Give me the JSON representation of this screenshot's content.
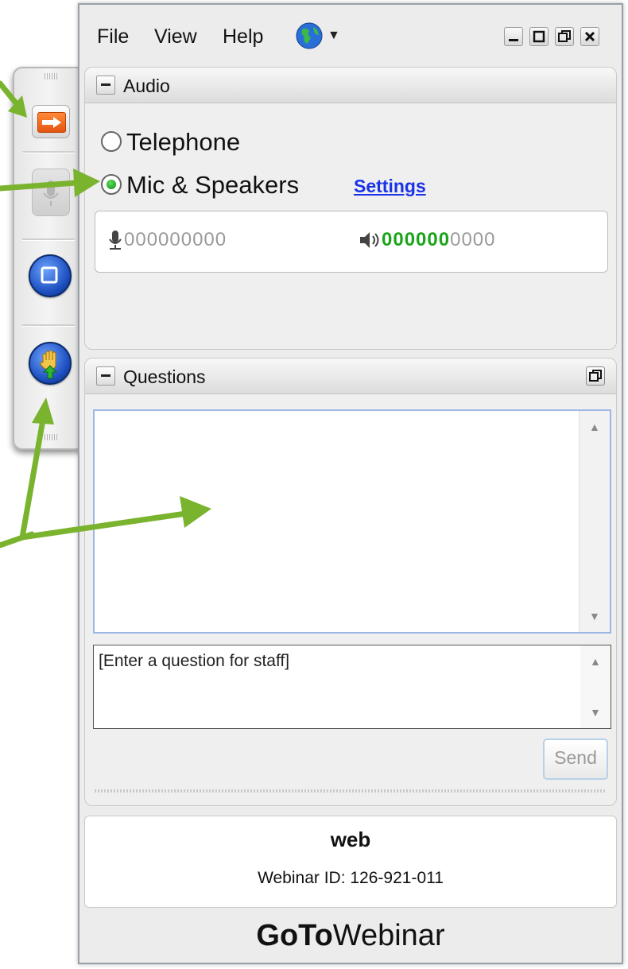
{
  "menu": {
    "file": "File",
    "view": "View",
    "help": "Help"
  },
  "audio": {
    "title": "Audio",
    "telephone": "Telephone",
    "mic_speakers": "Mic & Speakers",
    "settings_link": "Settings",
    "mic_level": "000000000",
    "speaker_level_active": "000000",
    "speaker_level_rest": "0000",
    "selected": "Mic & Speakers"
  },
  "questions": {
    "title": "Questions",
    "placeholder": "[Enter a question for staff]",
    "send_label": "Send"
  },
  "webinar": {
    "name": "web",
    "id_text": "Webinar ID: 126-921-011"
  },
  "brand": {
    "bold": "GoTo",
    "light": "Webinar"
  },
  "colors": {
    "annotation_arrow": "#7ab32e",
    "link": "#1a33e6",
    "level_active": "#1aa51a"
  }
}
